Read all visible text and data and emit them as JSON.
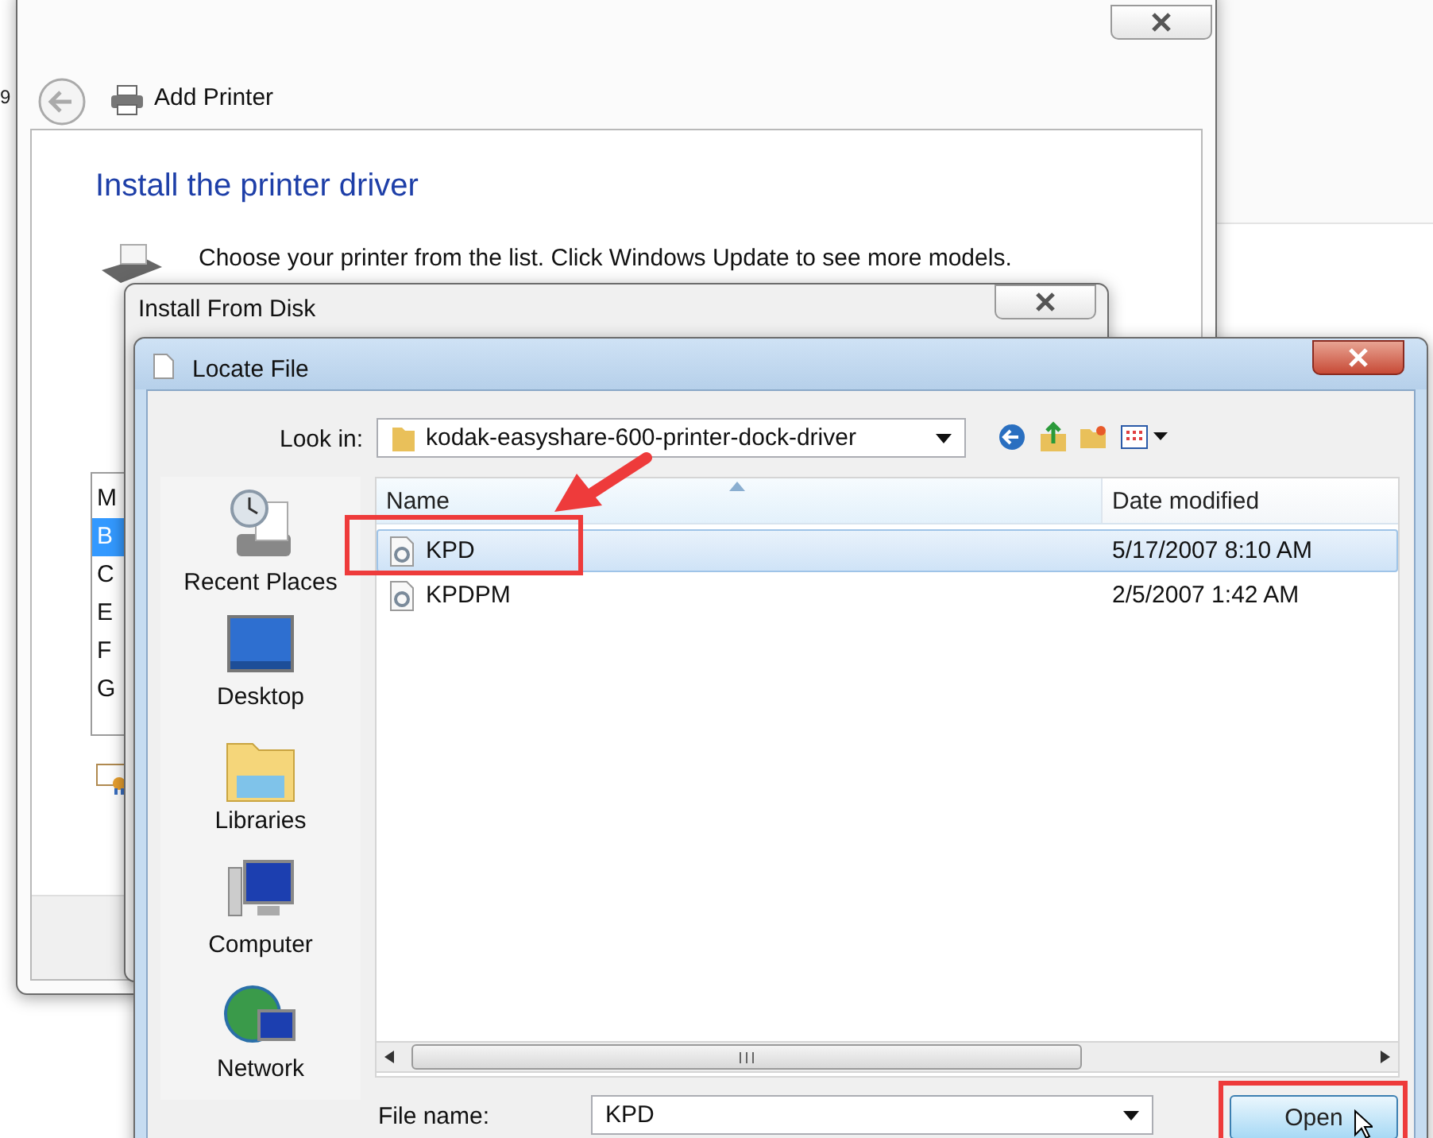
{
  "edge_text": "9",
  "add_printer_window": {
    "title": "Add Printer",
    "heading": "Install the printer driver",
    "instruction": "Choose your printer from the list. Click Windows Update to see more models.",
    "manufacturer_list": [
      {
        "label": "M",
        "selected": false
      },
      {
        "label": "B",
        "selected": true
      },
      {
        "label": "C",
        "selected": false
      },
      {
        "label": "E",
        "selected": false
      },
      {
        "label": "F",
        "selected": false
      },
      {
        "label": "G",
        "selected": false
      }
    ]
  },
  "install_from_disk_window": {
    "title": "Install From Disk"
  },
  "locate_file_window": {
    "title": "Locate File",
    "look_in_label": "Look in:",
    "look_in_value": "kodak-easyshare-600-printer-dock-driver",
    "places": [
      {
        "label": "Recent Places",
        "kind": "recent"
      },
      {
        "label": "Desktop",
        "kind": "desktop"
      },
      {
        "label": "Libraries",
        "kind": "libraries"
      },
      {
        "label": "Computer",
        "kind": "computer"
      },
      {
        "label": "Network",
        "kind": "network"
      }
    ],
    "columns": [
      "Name",
      "Date modified"
    ],
    "files": [
      {
        "name": "KPD",
        "date": "5/17/2007 8:10 AM",
        "selected": true
      },
      {
        "name": "KPDPM",
        "date": "2/5/2007 1:42 AM",
        "selected": false
      }
    ],
    "file_name_label": "File name:",
    "file_name_value": "KPD",
    "open_button": "Open"
  }
}
